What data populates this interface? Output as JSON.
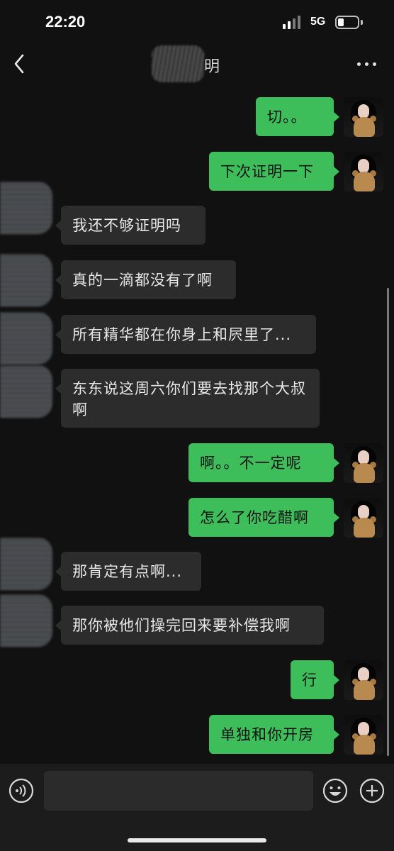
{
  "status_bar": {
    "time": "22:20",
    "network": "5G"
  },
  "nav": {
    "title_visible": "明"
  },
  "messages": [
    {
      "side": "out",
      "text": "切。。"
    },
    {
      "side": "out",
      "text": "下次证明一下"
    },
    {
      "side": "in",
      "text": "我还不够证明吗"
    },
    {
      "side": "in",
      "text": "真的一滴都没有了啊"
    },
    {
      "side": "in",
      "text": "所有精华都在你身上和屄里了..."
    },
    {
      "side": "in",
      "text": "东东说这周六你们要去找那个大叔啊"
    },
    {
      "side": "out",
      "text": "啊。。不一定呢"
    },
    {
      "side": "out",
      "text": "怎么了你吃醋啊"
    },
    {
      "side": "in",
      "text": "那肯定有点啊..."
    },
    {
      "side": "in",
      "text": "那你被他们操完回来要补偿我啊"
    },
    {
      "side": "out",
      "text": "行"
    },
    {
      "side": "out",
      "text": "单独和你开房"
    }
  ],
  "input": {
    "value": ""
  },
  "colors": {
    "outgoing_bubble": "#3dbe5a",
    "incoming_bubble": "#2c2c2c",
    "background": "#111111"
  },
  "icons": {
    "back": "chevron-left-icon",
    "more": "more-dots-icon",
    "voice": "voice-icon",
    "emoji": "emoji-icon",
    "plus": "plus-icon"
  }
}
